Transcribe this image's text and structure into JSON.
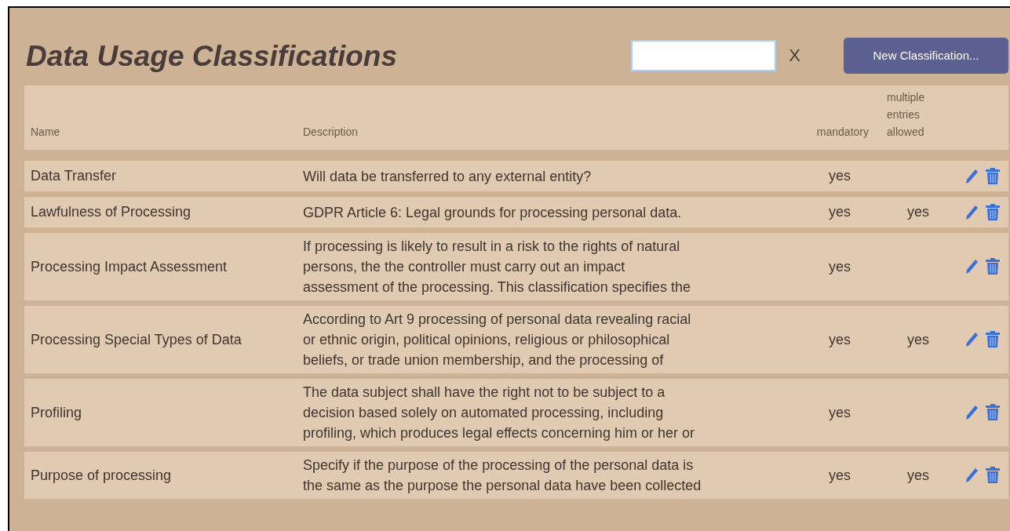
{
  "title": "Data Usage Classifications",
  "search": {
    "clear_label": "X"
  },
  "new_button": "New Classification...",
  "columns": [
    "Name",
    "Description",
    "mandatory",
    "multiple entries allowed"
  ],
  "rows": [
    {
      "name": "Data Transfer",
      "description_lines": [
        "Will data be transferred to any external entity?"
      ],
      "mandatory": "yes"
    },
    {
      "name": "Lawfulness of Processing",
      "description_lines": [
        "GDPR Article 6: Legal grounds for processing personal data."
      ],
      "mandatory": "yes",
      "multiple": "yes"
    },
    {
      "name": "Processing Impact Assessment",
      "description_lines": [
        "If processing is likely to result in a risk to the rights of natural",
        "persons, the the controller must carry out an impact",
        "assessment of the processing. This classification specifies the"
      ],
      "mandatory": "yes"
    },
    {
      "name": "Processing Special Types of Data",
      "description_lines": [
        "According to Art 9 processing of personal data revealing racial",
        "or ethnic origin, political opinions, religious or philosophical",
        "beliefs, or trade union membership, and the processing of"
      ],
      "mandatory": "yes",
      "multiple": "yes"
    },
    {
      "name": "Profiling",
      "description_lines": [
        "The data subject shall have the right not to be subject to a",
        "decision based solely on automated processing, including",
        "profiling, which produces legal effects concerning him or her or"
      ],
      "mandatory": "yes"
    },
    {
      "name": "Purpose of processing",
      "description_lines": [
        "Specify if the purpose of the processing of the personal data is",
        "the same as the purpose the personal data have been collected"
      ],
      "mandatory": "yes",
      "multiple": "yes"
    }
  ]
}
